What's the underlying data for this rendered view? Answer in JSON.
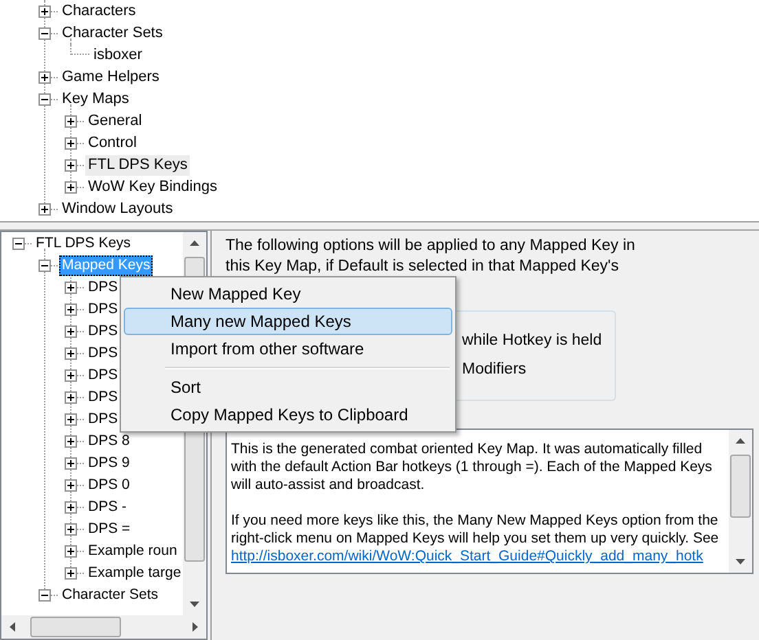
{
  "top_tree": {
    "focused": false,
    "items": [
      {
        "label": "Characters",
        "expanded": false,
        "selected": false
      },
      {
        "label": "Character Sets",
        "expanded": true,
        "selected": false,
        "children": [
          {
            "label": "isboxer",
            "selected": false
          }
        ]
      },
      {
        "label": "Game Helpers",
        "expanded": false,
        "selected": false
      },
      {
        "label": "Key Maps",
        "expanded": true,
        "selected": false,
        "children": [
          {
            "label": "General",
            "expanded": false,
            "selected": false
          },
          {
            "label": "Control",
            "expanded": false,
            "selected": false
          },
          {
            "label": "FTL DPS Keys",
            "expanded": false,
            "selected": true
          },
          {
            "label": "WoW Key Bindings",
            "expanded": false,
            "selected": false
          }
        ]
      },
      {
        "label": "Window Layouts",
        "expanded": false,
        "selected": false
      }
    ]
  },
  "bottom_tree": {
    "focused": true,
    "items": [
      {
        "label": "FTL DPS Keys",
        "expanded": true,
        "selected": false,
        "children": [
          {
            "label": "Mapped Keys",
            "expanded": true,
            "selected": true,
            "children": [
              {
                "label": "DPS",
                "expanded": false,
                "selected": false
              },
              {
                "label": "DPS",
                "expanded": false,
                "selected": false
              },
              {
                "label": "DPS",
                "expanded": false,
                "selected": false
              },
              {
                "label": "DPS",
                "expanded": false,
                "selected": false
              },
              {
                "label": "DPS",
                "expanded": false,
                "selected": false
              },
              {
                "label": "DPS",
                "expanded": false,
                "selected": false
              },
              {
                "label": "DPS",
                "expanded": false,
                "selected": false
              },
              {
                "label": "DPS 8",
                "expanded": false,
                "selected": false
              },
              {
                "label": "DPS 9",
                "expanded": false,
                "selected": false
              },
              {
                "label": "DPS 0",
                "expanded": false,
                "selected": false
              },
              {
                "label": "DPS -",
                "expanded": false,
                "selected": false
              },
              {
                "label": "DPS =",
                "expanded": false,
                "selected": false
              },
              {
                "label": "Example roun",
                "expanded": false,
                "selected": false
              },
              {
                "label": "Example targe",
                "expanded": false,
                "selected": false
              }
            ]
          },
          {
            "label": "Character Sets",
            "expanded": true,
            "selected": false
          }
        ]
      }
    ]
  },
  "options_panel": {
    "intro_lines": [
      "The following options will be applied to any Mapped Key in",
      "this Key Map, if Default is selected in that Mapped Key's"
    ],
    "group_lines": [
      "while Hotkey is held",
      "Modifiers"
    ],
    "description": {
      "paragraphs": [
        [
          "This is the generated combat oriented Key Map. It was automatically filled",
          "with the default Action Bar hotkeys (1 through =). Each of the Mapped Keys",
          "will auto-assist and broadcast."
        ],
        [
          "If you need more keys like this, the Many New Mapped Keys option from the",
          "right-click menu on Mapped Keys will help you set them up very quickly. See"
        ]
      ],
      "link": "http://isboxer.com/wiki/WoW:Quick_Start_Guide#Quickly_add_many_hotk"
    }
  },
  "context_menu": {
    "items": [
      {
        "kind": "item",
        "label": "New Mapped Key",
        "selected": false
      },
      {
        "kind": "item",
        "label": "Many new Mapped Keys",
        "selected": true
      },
      {
        "kind": "item",
        "label": "Import from other software",
        "selected": false
      },
      {
        "kind": "separator"
      },
      {
        "kind": "item",
        "label": "Sort",
        "selected": false
      },
      {
        "kind": "item",
        "label": "Copy Mapped Keys to Clipboard",
        "selected": false
      }
    ]
  }
}
